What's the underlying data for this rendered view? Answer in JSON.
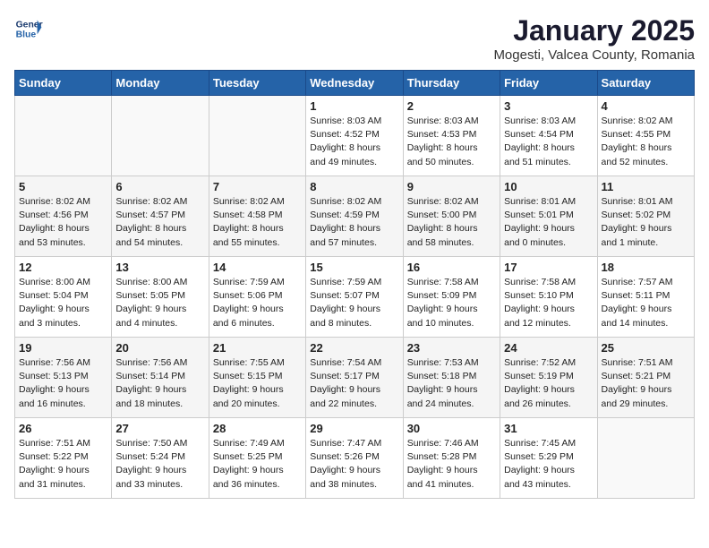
{
  "header": {
    "logo_line1": "General",
    "logo_line2": "Blue",
    "title": "January 2025",
    "subtitle": "Mogesti, Valcea County, Romania"
  },
  "weekdays": [
    "Sunday",
    "Monday",
    "Tuesday",
    "Wednesday",
    "Thursday",
    "Friday",
    "Saturday"
  ],
  "weeks": [
    [
      {
        "day": "",
        "info": ""
      },
      {
        "day": "",
        "info": ""
      },
      {
        "day": "",
        "info": ""
      },
      {
        "day": "1",
        "info": "Sunrise: 8:03 AM\nSunset: 4:52 PM\nDaylight: 8 hours\nand 49 minutes."
      },
      {
        "day": "2",
        "info": "Sunrise: 8:03 AM\nSunset: 4:53 PM\nDaylight: 8 hours\nand 50 minutes."
      },
      {
        "day": "3",
        "info": "Sunrise: 8:03 AM\nSunset: 4:54 PM\nDaylight: 8 hours\nand 51 minutes."
      },
      {
        "day": "4",
        "info": "Sunrise: 8:02 AM\nSunset: 4:55 PM\nDaylight: 8 hours\nand 52 minutes."
      }
    ],
    [
      {
        "day": "5",
        "info": "Sunrise: 8:02 AM\nSunset: 4:56 PM\nDaylight: 8 hours\nand 53 minutes."
      },
      {
        "day": "6",
        "info": "Sunrise: 8:02 AM\nSunset: 4:57 PM\nDaylight: 8 hours\nand 54 minutes."
      },
      {
        "day": "7",
        "info": "Sunrise: 8:02 AM\nSunset: 4:58 PM\nDaylight: 8 hours\nand 55 minutes."
      },
      {
        "day": "8",
        "info": "Sunrise: 8:02 AM\nSunset: 4:59 PM\nDaylight: 8 hours\nand 57 minutes."
      },
      {
        "day": "9",
        "info": "Sunrise: 8:02 AM\nSunset: 5:00 PM\nDaylight: 8 hours\nand 58 minutes."
      },
      {
        "day": "10",
        "info": "Sunrise: 8:01 AM\nSunset: 5:01 PM\nDaylight: 9 hours\nand 0 minutes."
      },
      {
        "day": "11",
        "info": "Sunrise: 8:01 AM\nSunset: 5:02 PM\nDaylight: 9 hours\nand 1 minute."
      }
    ],
    [
      {
        "day": "12",
        "info": "Sunrise: 8:00 AM\nSunset: 5:04 PM\nDaylight: 9 hours\nand 3 minutes."
      },
      {
        "day": "13",
        "info": "Sunrise: 8:00 AM\nSunset: 5:05 PM\nDaylight: 9 hours\nand 4 minutes."
      },
      {
        "day": "14",
        "info": "Sunrise: 7:59 AM\nSunset: 5:06 PM\nDaylight: 9 hours\nand 6 minutes."
      },
      {
        "day": "15",
        "info": "Sunrise: 7:59 AM\nSunset: 5:07 PM\nDaylight: 9 hours\nand 8 minutes."
      },
      {
        "day": "16",
        "info": "Sunrise: 7:58 AM\nSunset: 5:09 PM\nDaylight: 9 hours\nand 10 minutes."
      },
      {
        "day": "17",
        "info": "Sunrise: 7:58 AM\nSunset: 5:10 PM\nDaylight: 9 hours\nand 12 minutes."
      },
      {
        "day": "18",
        "info": "Sunrise: 7:57 AM\nSunset: 5:11 PM\nDaylight: 9 hours\nand 14 minutes."
      }
    ],
    [
      {
        "day": "19",
        "info": "Sunrise: 7:56 AM\nSunset: 5:13 PM\nDaylight: 9 hours\nand 16 minutes."
      },
      {
        "day": "20",
        "info": "Sunrise: 7:56 AM\nSunset: 5:14 PM\nDaylight: 9 hours\nand 18 minutes."
      },
      {
        "day": "21",
        "info": "Sunrise: 7:55 AM\nSunset: 5:15 PM\nDaylight: 9 hours\nand 20 minutes."
      },
      {
        "day": "22",
        "info": "Sunrise: 7:54 AM\nSunset: 5:17 PM\nDaylight: 9 hours\nand 22 minutes."
      },
      {
        "day": "23",
        "info": "Sunrise: 7:53 AM\nSunset: 5:18 PM\nDaylight: 9 hours\nand 24 minutes."
      },
      {
        "day": "24",
        "info": "Sunrise: 7:52 AM\nSunset: 5:19 PM\nDaylight: 9 hours\nand 26 minutes."
      },
      {
        "day": "25",
        "info": "Sunrise: 7:51 AM\nSunset: 5:21 PM\nDaylight: 9 hours\nand 29 minutes."
      }
    ],
    [
      {
        "day": "26",
        "info": "Sunrise: 7:51 AM\nSunset: 5:22 PM\nDaylight: 9 hours\nand 31 minutes."
      },
      {
        "day": "27",
        "info": "Sunrise: 7:50 AM\nSunset: 5:24 PM\nDaylight: 9 hours\nand 33 minutes."
      },
      {
        "day": "28",
        "info": "Sunrise: 7:49 AM\nSunset: 5:25 PM\nDaylight: 9 hours\nand 36 minutes."
      },
      {
        "day": "29",
        "info": "Sunrise: 7:47 AM\nSunset: 5:26 PM\nDaylight: 9 hours\nand 38 minutes."
      },
      {
        "day": "30",
        "info": "Sunrise: 7:46 AM\nSunset: 5:28 PM\nDaylight: 9 hours\nand 41 minutes."
      },
      {
        "day": "31",
        "info": "Sunrise: 7:45 AM\nSunset: 5:29 PM\nDaylight: 9 hours\nand 43 minutes."
      },
      {
        "day": "",
        "info": ""
      }
    ]
  ]
}
